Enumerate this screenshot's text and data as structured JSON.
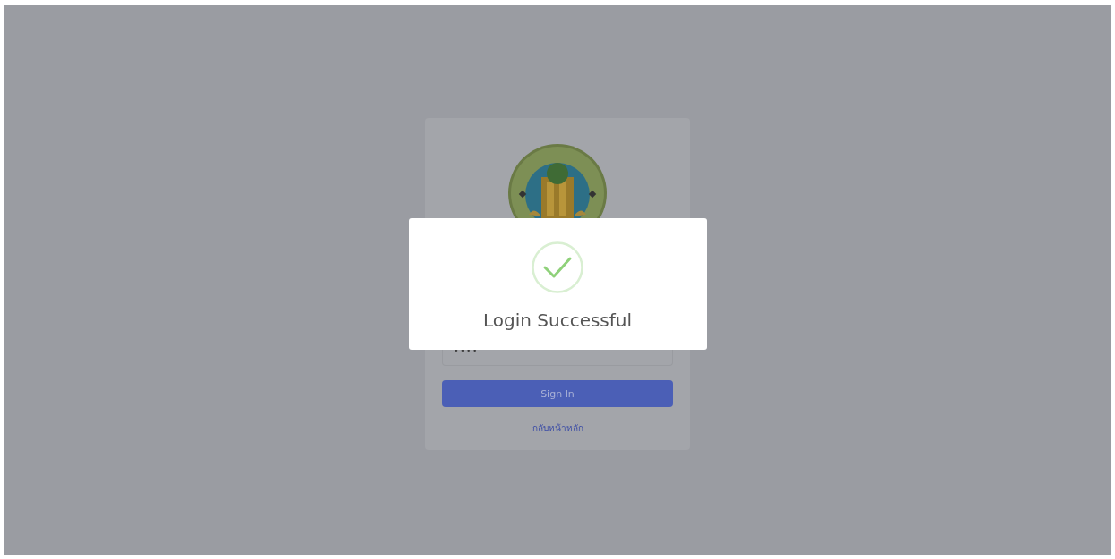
{
  "login_card": {
    "password_value": "••••",
    "sign_in_button": "Sign In",
    "back_link": "กลับหน้าหลัก"
  },
  "alert": {
    "kind": "success",
    "message": "Login Successful"
  }
}
